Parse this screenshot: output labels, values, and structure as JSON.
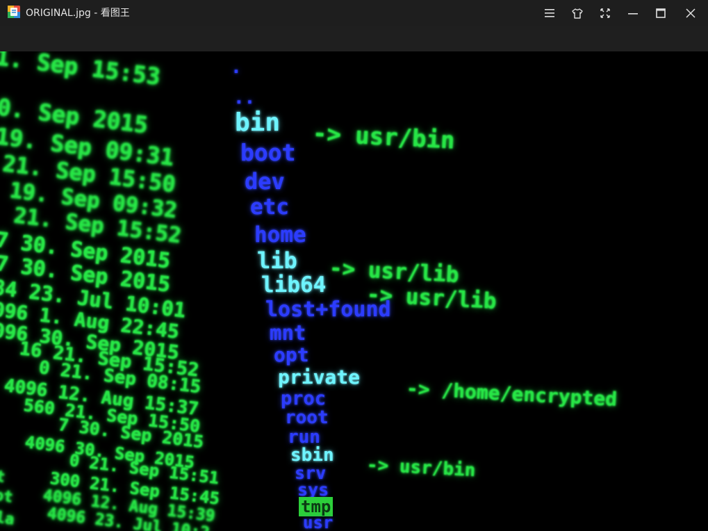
{
  "window": {
    "title": "ORIGINAL.jpg - 看图王"
  },
  "titlebar": {
    "icons": [
      "app-icon",
      "menu-icon",
      "skin-icon",
      "fullscreen-icon",
      "minimize-icon",
      "maximize-icon",
      "close-icon"
    ]
  },
  "image": {
    "listing": [
      {
        "meta": "1. Sep 15:53"
      },
      {
        "meta": "0. Sep 2015",
        "name": "bin",
        "target": "-> usr/bin"
      },
      {
        "meta": "19. Sep 09:31",
        "name": "boot"
      },
      {
        "meta": "21. Sep 15:50",
        "name": "dev"
      },
      {
        "meta": "19. Sep 09:32",
        "name": "etc"
      },
      {
        "meta": "21. Sep 15:52",
        "name": "home"
      },
      {
        "meta": "7 30. Sep 2015",
        "name": "lib",
        "target": "-> usr/lib"
      },
      {
        "meta": "7 30. Sep 2015",
        "name": "lib64",
        "target": "-> usr/lib"
      },
      {
        "meta": "84 23. Jul 10:01",
        "name": "lost+found"
      },
      {
        "meta": "096 1. Aug 22:45",
        "name": "mnt"
      },
      {
        "meta": "096 30. Sep 2015",
        "name": "opt"
      },
      {
        "meta": "16 21. Sep 15:52",
        "name": "private",
        "target": "-> /home/encrypted"
      },
      {
        "meta": "0 21. Sep 08:15",
        "name": "proc"
      },
      {
        "meta": "4096 12. Aug 15:37",
        "name": "root"
      },
      {
        "meta": "560 21. Sep 15:50",
        "name": "run"
      },
      {
        "meta": "7 30. Sep 2015",
        "name": "sbin",
        "target": "-> usr/bin"
      },
      {
        "meta": "4096 30. Sep 2015",
        "name": "srv"
      },
      {
        "meta": "0 21. Sep 15:51",
        "name": "sys"
      },
      {
        "meta": "300 21. Sep 15:45",
        "name": "tmp"
      },
      {
        "meta": "4096 12. Aug 15:39",
        "name": "usr"
      },
      {
        "meta": "4096 23. Jul 10:2",
        "name": ""
      }
    ],
    "top_dots": [
      ".",
      ".."
    ],
    "left_fragments": [
      "t",
      "ot",
      "la"
    ],
    "colors": {
      "green": "#27e646",
      "blue": "#2c3cff",
      "cyan": "#6ef4ff",
      "highlight": "#2ccf3a"
    }
  }
}
